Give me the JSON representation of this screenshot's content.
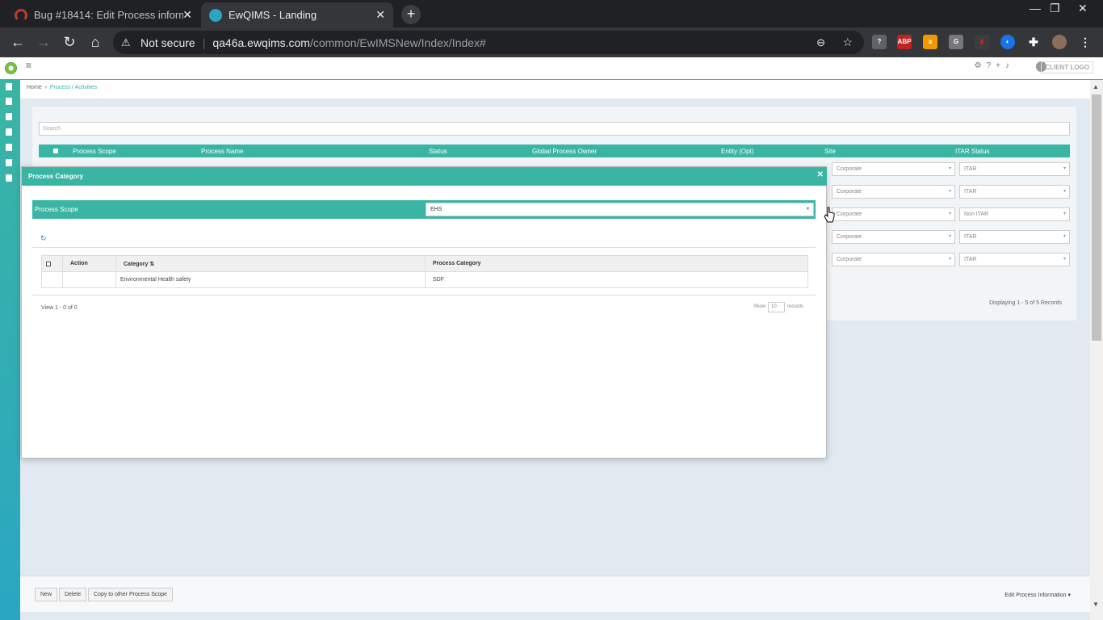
{
  "browser": {
    "tabs": [
      {
        "title": "Bug #18414: Edit Process informa"
      },
      {
        "title": "EwQIMS - Landing"
      }
    ],
    "address": {
      "security": "Not secure",
      "host": "qa46a.ewqims.com",
      "path": "/common/EwIMSNew/Index/Index#"
    }
  },
  "header": {
    "client_logo": "CLIENT LOGO"
  },
  "breadcrumb": {
    "home": "Home",
    "current": "Process / Activities"
  },
  "panel": {
    "search_placeholder": "Search",
    "columns": [
      "Process Scope",
      "Process Name",
      "Status",
      "Global Process Owner",
      "Entity (Opt)",
      "Site",
      "ITAR Status"
    ],
    "rows": [
      {
        "site": "Corporate",
        "itar": "ITAR"
      },
      {
        "site": "Corporate",
        "itar": "ITAR"
      },
      {
        "site": "Corporate",
        "itar": "Non ITAR"
      },
      {
        "site": "Corporate",
        "itar": "ITAR"
      },
      {
        "site": "Corporate",
        "itar": "ITAR"
      }
    ],
    "displaying": "Displaying 1 - 5 of 5 Records"
  },
  "bottom": {
    "new": "New",
    "delete": "Delete",
    "copy": "Copy to other Process Scope",
    "edit_info": "Edit Process Information"
  },
  "modal": {
    "title": "Process Category",
    "scope_label": "Process Scope",
    "scope_value": "EHS",
    "table": {
      "headers": [
        "Action",
        "Category",
        "Process Category"
      ],
      "rows": [
        {
          "category": "Environmental Health safety",
          "process_category": "SDF"
        }
      ]
    },
    "view_info": "View 1 - 0 of 0",
    "show_label": "Show",
    "show_value": "10",
    "records_label": "records"
  },
  "colors": {
    "accent": "#3ab5a4",
    "background": "#e1e9f1"
  }
}
